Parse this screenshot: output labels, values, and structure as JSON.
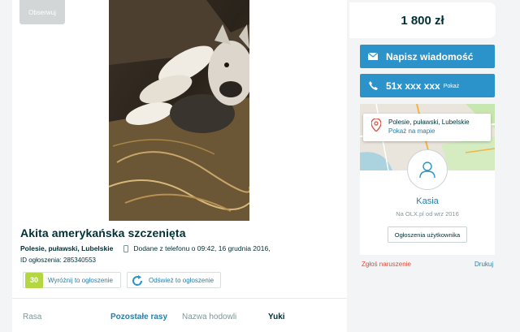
{
  "observe": {
    "label": "Obserwuj",
    "icon": "star-icon"
  },
  "ad": {
    "title": "Akita amerykańska szczenięta",
    "location": "Polesie, puławski, Lubelskie",
    "added": "Dodane z telefonu   o 09:42, 16 grudnia 2016,",
    "id_line": "ID ogłoszenia: 285340553"
  },
  "promo": {
    "highlight_badge": "30",
    "highlight_label": "Wyróżnij to ogłoszenie",
    "refresh_label": "Odśwież to ogłoszenie"
  },
  "attributes": [
    {
      "key": "Rasa",
      "value": "Pozostałe rasy"
    },
    {
      "key": "Nazwa hodowli",
      "value": "Yuki"
    }
  ],
  "sidebar": {
    "price": "1 800 zł",
    "message_button": "Napisz wiadomość",
    "phone_number": "51x xxx xxx",
    "phone_show": "Pokaż",
    "map_location": "Polesie, puławski, Lubelskie",
    "map_link": "Pokaż na mapie",
    "user_name": "Kasia",
    "user_since": "Na OLX.pl od wrz 2016",
    "user_ads_button": "Ogłoszenia użytkownika",
    "report": "Zgłoś naruszenie",
    "print": "Drukuj"
  },
  "colors": {
    "accent": "#2b93c9",
    "link": "#2b7ea3",
    "report": "#e24a3b",
    "badge": "#b3d641"
  }
}
